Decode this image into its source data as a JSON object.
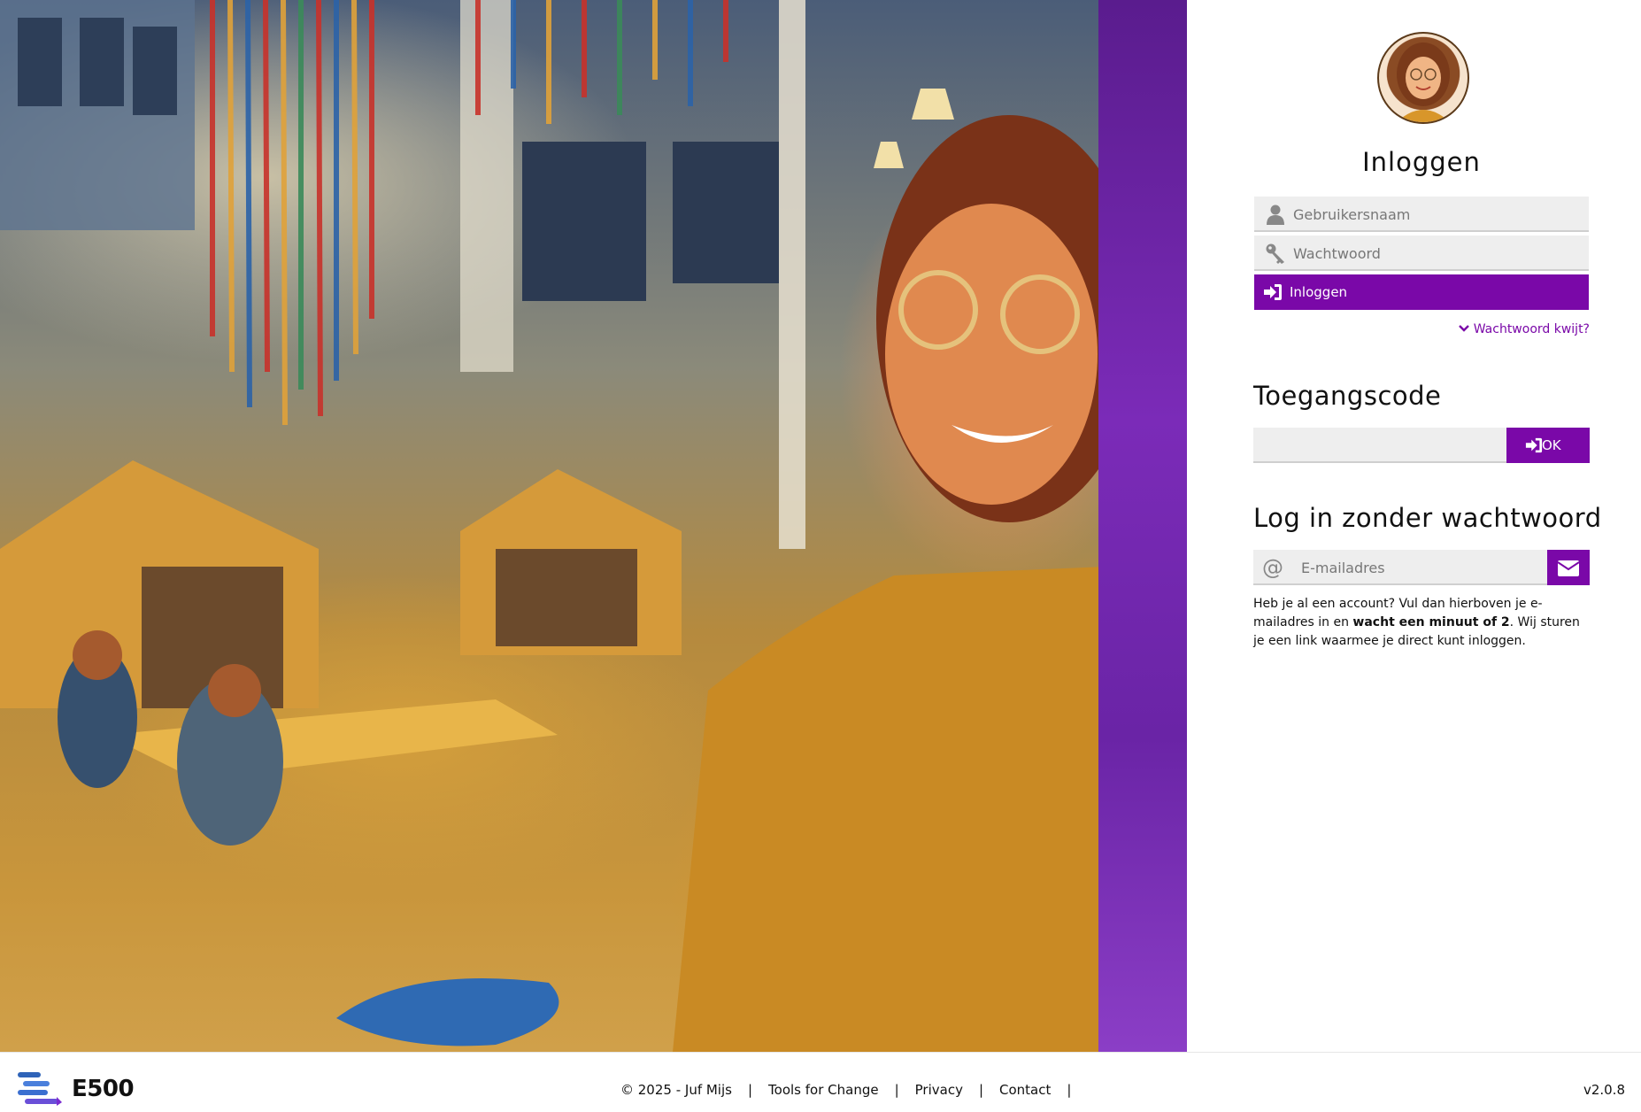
{
  "login": {
    "title": "Inloggen",
    "username_placeholder": "Gebruikersnaam",
    "password_placeholder": "Wachtwoord",
    "submit_label": "Inloggen",
    "forgot_label": "Wachtwoord kwijt?"
  },
  "access_code": {
    "title": "Toegangscode",
    "ok_label": "OK"
  },
  "passwordless": {
    "title": "Log in zonder wachtwoord",
    "email_placeholder": "E-mailadres",
    "hint_before": "Heb je al een account? Vul dan hierboven je e-mailadres in en ",
    "hint_bold": "wacht een minuut of 2",
    "hint_after": ". Wij sturen je een link waarmee je direct kunt inloggen."
  },
  "footer": {
    "logo_text": "E500",
    "copyright": "© 2025 - Juf Mijs",
    "link_tools": "Tools for Change",
    "link_privacy": "Privacy",
    "link_contact": "Contact",
    "separator": "|",
    "version": "v2.0.8"
  },
  "colors": {
    "accent": "#7a08a8",
    "field_bg": "#eeeeee"
  },
  "icons": [
    "user-icon",
    "key-icon",
    "sign-in-icon",
    "chevron-down-icon",
    "at-icon",
    "envelope-icon"
  ]
}
